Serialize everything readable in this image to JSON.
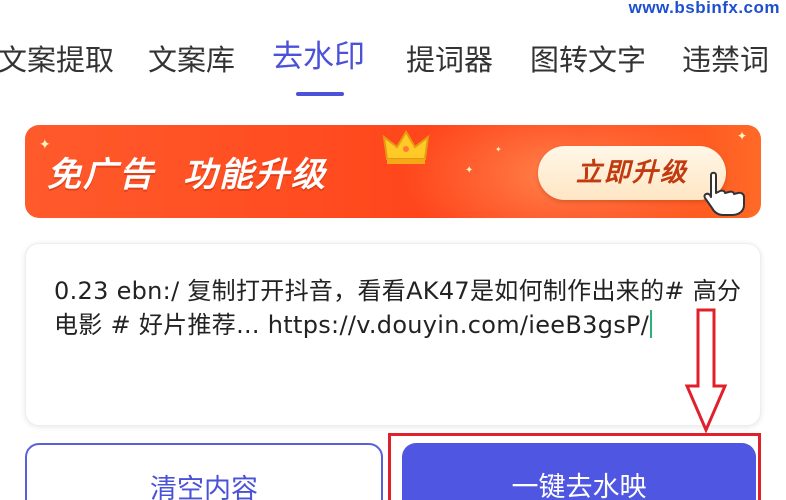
{
  "watermark": "www.bsbinfx.com",
  "tabs": [
    {
      "label": "文案提取",
      "active": false
    },
    {
      "label": "文案库",
      "active": false
    },
    {
      "label": "去水印",
      "active": true
    },
    {
      "label": "提词器",
      "active": false
    },
    {
      "label": "图转文字",
      "active": false
    },
    {
      "label": "违禁词",
      "active": false
    }
  ],
  "banner": {
    "text_part1": "免广告",
    "text_part2": "功能升级",
    "button_label": "立即升级"
  },
  "input": {
    "value": "0.23 ebn:/ 复制打开抖音，看看AK47是如何制作出来的# 高分电影 # 好片推荐... https://v.douyin.com/ieeB3gsP/"
  },
  "actions": {
    "clear_label": "清空内容",
    "remove_label": "一键去水映"
  },
  "colors": {
    "accent": "#4b52d8",
    "button_primary": "#4f56e2",
    "banner_red": "#ff4a1e",
    "annotation_red": "#e0202a",
    "watermark_blue": "#1d4fcf"
  }
}
